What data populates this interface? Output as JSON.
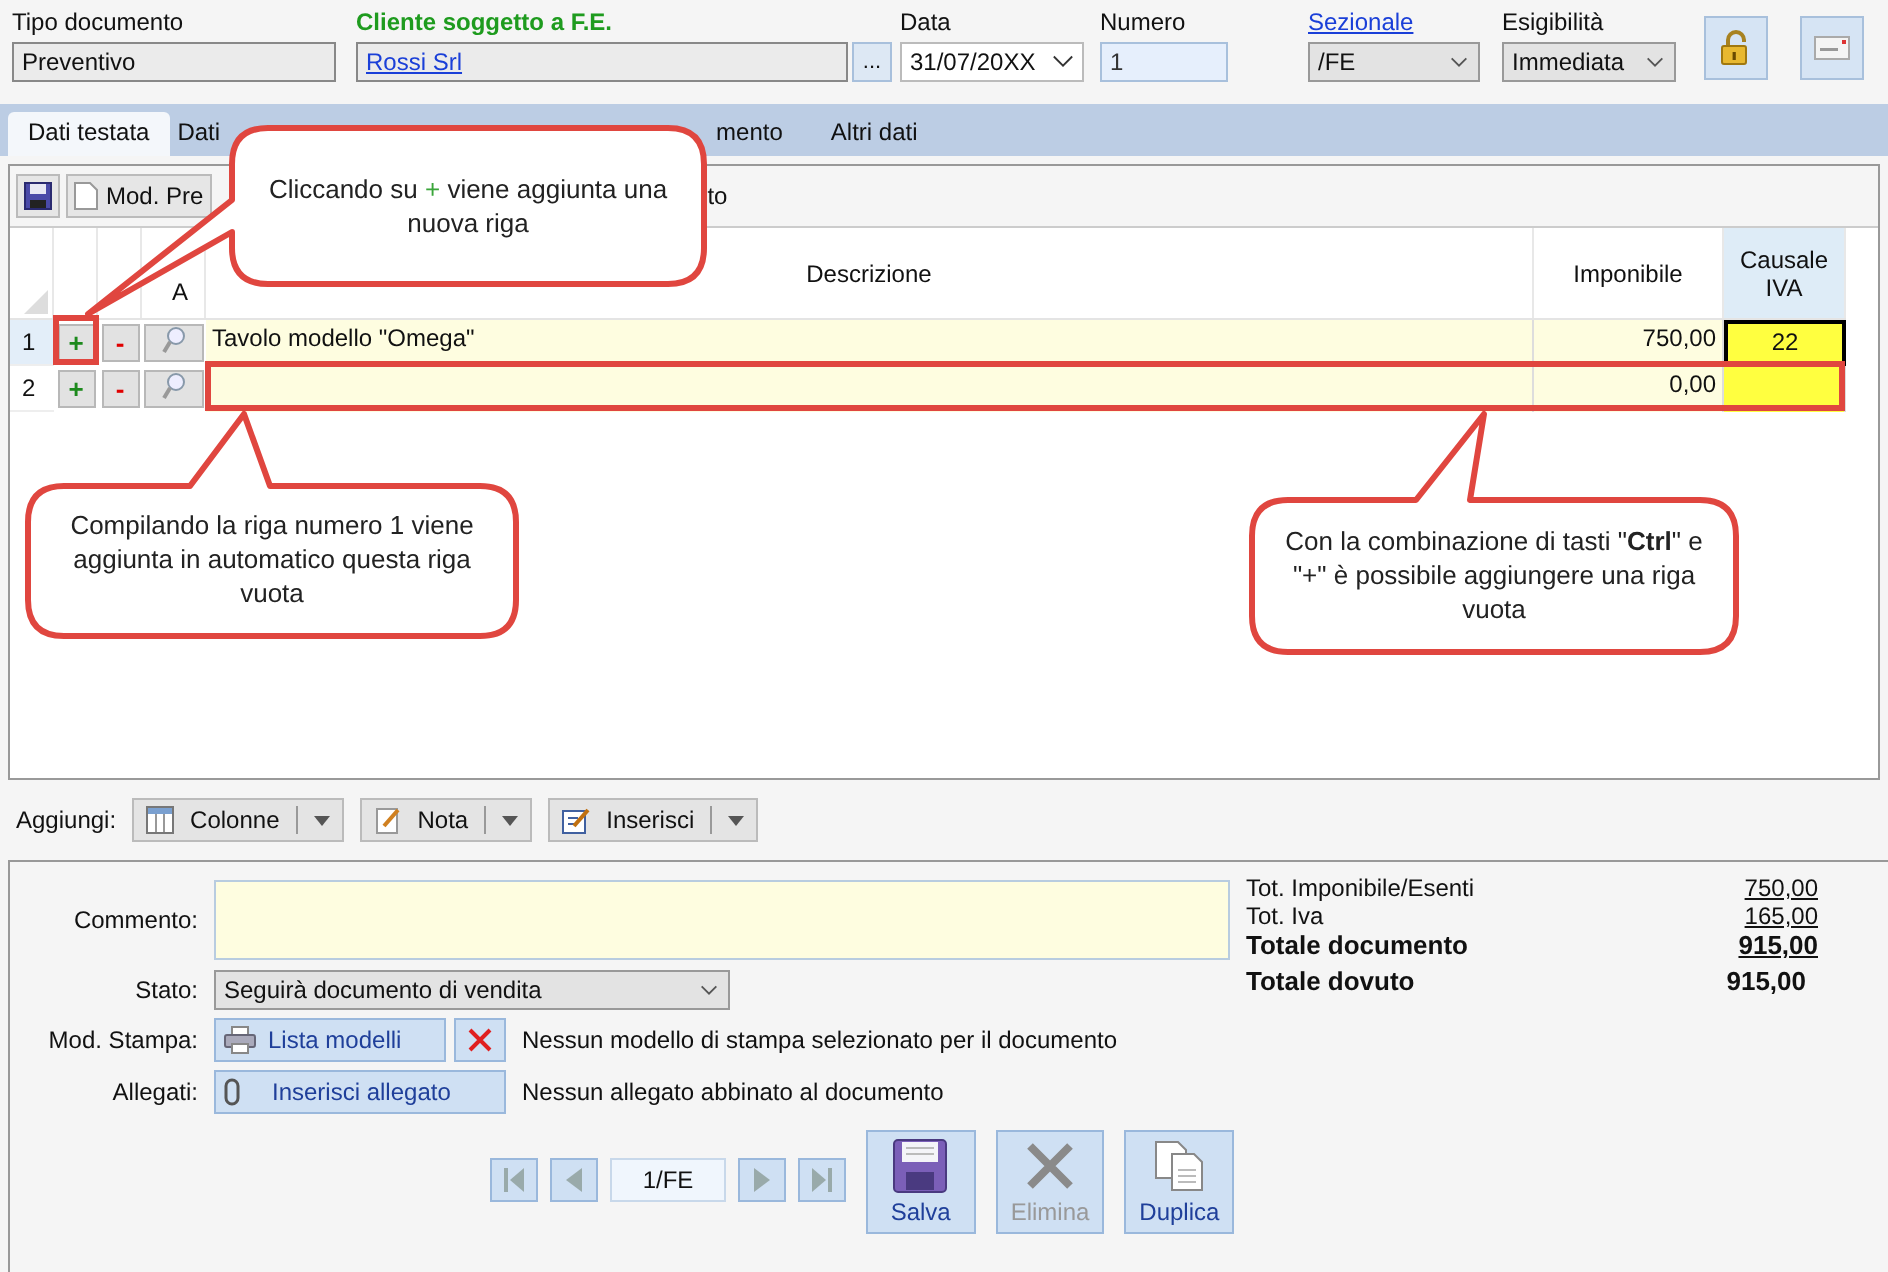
{
  "header": {
    "tipo_documento": {
      "label": "Tipo documento",
      "value": "Preventivo"
    },
    "cliente": {
      "label": "Cliente soggetto a F.E.",
      "value": "Rossi Srl",
      "browse": "..."
    },
    "data": {
      "label": "Data",
      "value": "31/07/20XX"
    },
    "numero": {
      "label": "Numero",
      "value": "1"
    },
    "sezionale": {
      "label": "Sezionale",
      "value": "/FE"
    },
    "esigibilita": {
      "label": "Esigibilità",
      "value": "Immediata"
    }
  },
  "tabs": [
    {
      "label": "Dati testata",
      "selected": true
    },
    {
      "label": "Dati",
      "selected": false
    },
    {
      "label": "mento",
      "selected": false
    },
    {
      "label": "Altri dati",
      "selected": false
    }
  ],
  "toolbar": {
    "model_button": "Mod. Pre",
    "fragment": "to"
  },
  "grid": {
    "columns": [
      "A",
      "Descrizione",
      "Imponibile",
      "Causale IVA"
    ],
    "rows": [
      {
        "number": "1",
        "add": "+",
        "remove": "-",
        "description": "Tavolo modello \"Omega\"",
        "imponibile": "750,00",
        "causale_iva": "22",
        "selected": true
      },
      {
        "number": "2",
        "add": "+",
        "remove": "-",
        "imponibile": "0,00",
        "selected": false
      }
    ]
  },
  "aggiungi": {
    "label": "Aggiungi:",
    "buttons": [
      {
        "label": "Colonne",
        "kind": "columns"
      },
      {
        "label": "Nota",
        "kind": "note"
      },
      {
        "label": "Inserisci",
        "kind": "insert"
      }
    ]
  },
  "form": {
    "commento_label": "Commento:",
    "stato_label": "Stato:",
    "stato": "Seguirà documento di vendita",
    "stampa_label": "Mod. Stampa:",
    "stampa_button": "Lista modelli",
    "stampa_message": "Nessun modello di stampa selezionato per il documento",
    "allegati_label": "Allegati:",
    "allegati_button": "Inserisci allegato",
    "allegati_message": "Nessun allegato abbinato al documento"
  },
  "navigator": {
    "value": "1/FE"
  },
  "actions": [
    {
      "label": "Salva",
      "kind": "save",
      "disabled": false
    },
    {
      "label": "Elimina",
      "kind": "delete",
      "disabled": true
    },
    {
      "label": "Duplica",
      "kind": "duplicate",
      "disabled": false
    }
  ],
  "totals": [
    {
      "label": "Tot. Imponibile/Esenti",
      "value": "750,00",
      "kind": "subtotal"
    },
    {
      "label": "Tot. Iva",
      "value": "165,00",
      "kind": "subtotal"
    },
    {
      "label": "Totale documento",
      "value": "915,00",
      "kind": "total"
    },
    {
      "label": "Totale dovuto",
      "value": "915,00",
      "kind": "due"
    }
  ],
  "callouts": [
    {
      "text_before": "Cliccando su ",
      "symbol": "+",
      "text_after": " viene aggiunta una nuova riga"
    },
    {
      "text": "Compilando la riga numero 1 viene aggiunta in automatico questa riga vuota"
    },
    {
      "text": "Con la combinazione di tasti \"**Ctrl**\" e \"+\" è possibile aggiungere una riga vuota"
    }
  ]
}
